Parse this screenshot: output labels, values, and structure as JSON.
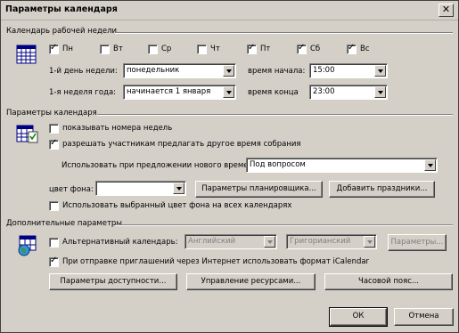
{
  "window": {
    "title": "Параметры календаря"
  },
  "work_week": {
    "section_title": "Календарь рабочей недели",
    "days": [
      {
        "label": "Пн",
        "checked": true
      },
      {
        "label": "Вт",
        "checked": false
      },
      {
        "label": "Ср",
        "checked": false
      },
      {
        "label": "Чт",
        "checked": false
      },
      {
        "label": "Пт",
        "checked": true
      },
      {
        "label": "Сб",
        "checked": true
      },
      {
        "label": "Вс",
        "checked": true
      }
    ],
    "first_day_label": "1-й день недели:",
    "first_day_value": "понедельник",
    "start_time_label": "время начала:",
    "start_time_value": "15:00",
    "first_week_label": "1-я неделя года:",
    "first_week_value": "начинается 1 января",
    "end_time_label": "время конца",
    "end_time_value": "23:00"
  },
  "calendar_options": {
    "section_title": "Параметры календаря",
    "show_week_numbers": {
      "label": "показывать номера недель",
      "checked": false
    },
    "allow_propose": {
      "label": "разрешать участникам предлагать другое время собрания",
      "checked": true
    },
    "propose_label": "Использовать при предложении нового времени:",
    "propose_value": "Под вопросом",
    "bg_color_label": "цвет фона:",
    "bg_color_value": "",
    "planner_button": "Параметры планировщика...",
    "add_holidays_button": "Добавить праздники...",
    "use_bg_all": {
      "label": "Использовать выбранный цвет фона на всех календарях",
      "checked": false
    }
  },
  "advanced": {
    "section_title": "Дополнительные параметры",
    "alt_calendar": {
      "label": "Альтернативный календарь:",
      "checked": false
    },
    "alt_lang_value": "Английский",
    "alt_type_value": "Григорианский",
    "alt_params_button": "Параметры...",
    "icalendar": {
      "label": "При отправке приглашений через Интернет использовать формат iCalendar",
      "checked": true
    },
    "availability_button": "Параметры доступности...",
    "resources_button": "Управление ресурсами...",
    "timezone_button": "Часовой пояс..."
  },
  "footer": {
    "ok": "ОК",
    "cancel": "Отмена"
  }
}
